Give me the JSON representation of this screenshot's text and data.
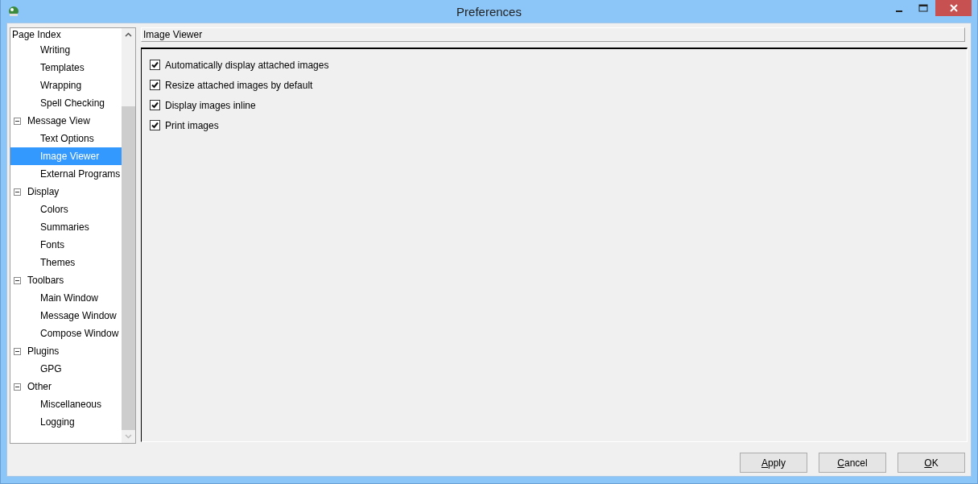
{
  "window": {
    "title": "Preferences"
  },
  "tree": {
    "header": "Page Index",
    "leading_children": [
      {
        "label": "Writing",
        "selected": false
      },
      {
        "label": "Templates",
        "selected": false
      },
      {
        "label": "Wrapping",
        "selected": false
      },
      {
        "label": "Spell Checking",
        "selected": false
      }
    ],
    "nodes": [
      {
        "label": "Message View",
        "expanded": true,
        "selected": false,
        "children": [
          {
            "label": "Text Options",
            "selected": false
          },
          {
            "label": "Image Viewer",
            "selected": true
          },
          {
            "label": "External Programs",
            "selected": false
          }
        ]
      },
      {
        "label": "Display",
        "expanded": true,
        "selected": false,
        "children": [
          {
            "label": "Colors",
            "selected": false
          },
          {
            "label": "Summaries",
            "selected": false
          },
          {
            "label": "Fonts",
            "selected": false
          },
          {
            "label": "Themes",
            "selected": false
          }
        ]
      },
      {
        "label": "Toolbars",
        "expanded": true,
        "selected": false,
        "children": [
          {
            "label": "Main Window",
            "selected": false
          },
          {
            "label": "Message Window",
            "selected": false
          },
          {
            "label": "Compose Window",
            "selected": false
          }
        ]
      },
      {
        "label": "Plugins",
        "expanded": true,
        "selected": false,
        "children": [
          {
            "label": "GPG",
            "selected": false
          }
        ]
      },
      {
        "label": "Other",
        "expanded": true,
        "selected": false,
        "children": [
          {
            "label": "Miscellaneous",
            "selected": false
          },
          {
            "label": "Logging",
            "selected": false
          }
        ]
      }
    ]
  },
  "page": {
    "title": "Image Viewer",
    "options": [
      {
        "label": "Automatically display attached images",
        "checked": true
      },
      {
        "label": "Resize attached images by default",
        "checked": true
      },
      {
        "label": "Display images inline",
        "checked": true
      },
      {
        "label": "Print images",
        "checked": true
      }
    ]
  },
  "buttons": [
    {
      "label": "Apply"
    },
    {
      "label": "Cancel"
    },
    {
      "label": "OK"
    }
  ]
}
